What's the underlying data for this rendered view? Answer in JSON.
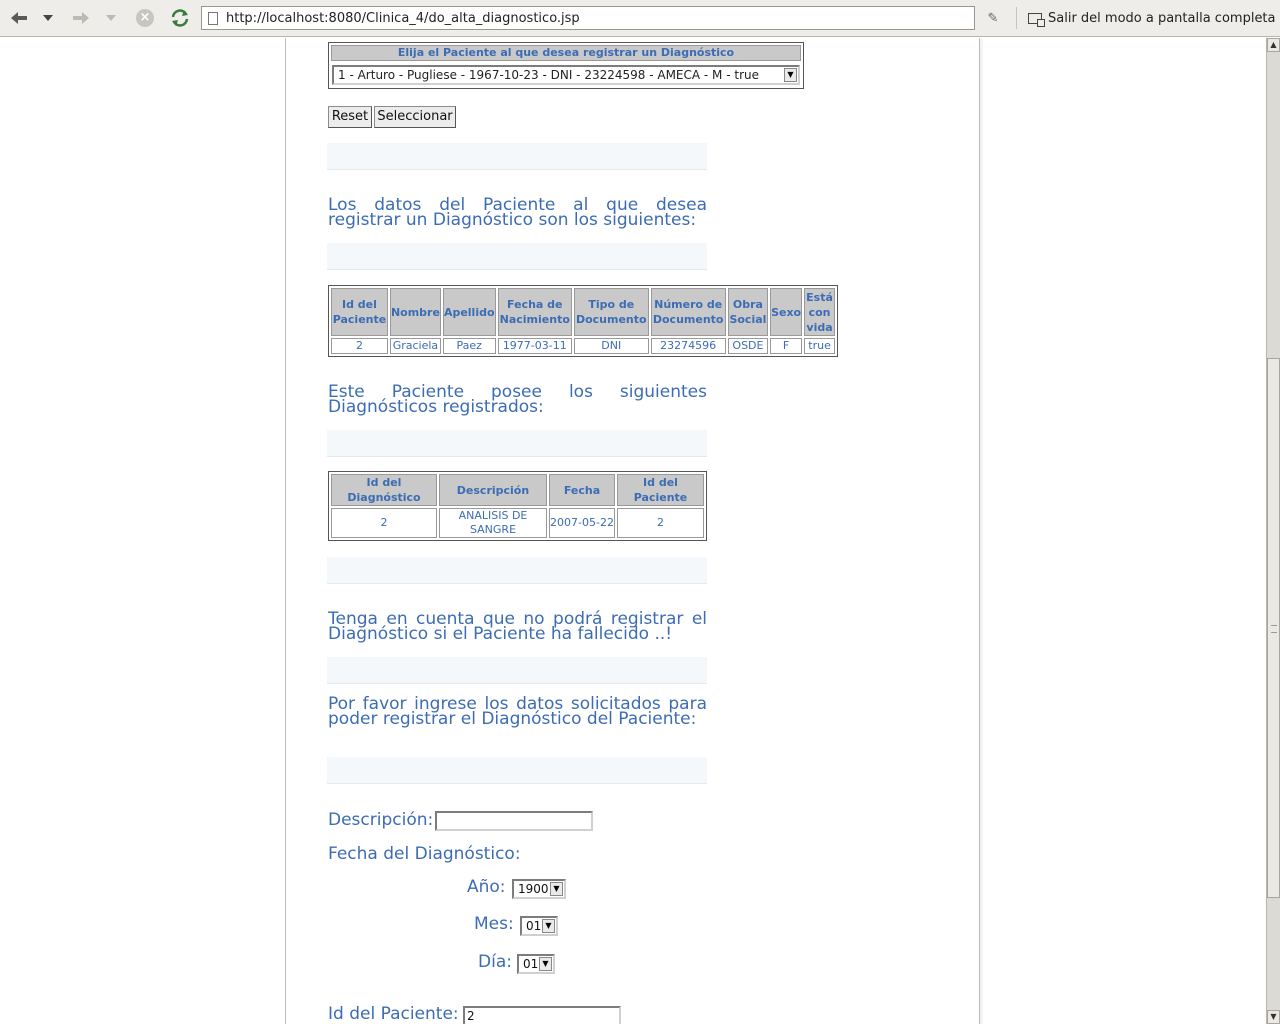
{
  "browser": {
    "url": "http://localhost:8080/Clinica_4/do_alta_diagnostico.jsp",
    "fullscreen_label": "Salir del modo a pantalla completa"
  },
  "patient_selector": {
    "header": "Elija el Paciente al que desea registrar un Diagnóstico",
    "selected": "1 - Arturo - Pugliese - 1967-10-23 - DNI - 23224598 - AMECA - M - true",
    "reset_label": "Reset",
    "select_label": "Seleccionar"
  },
  "patient_section": {
    "heading": "Los datos del Paciente al que desea registrar un Diagnóstico son los siguientes:",
    "columns": [
      "Id del Paciente",
      "Nombre",
      "Apellido",
      "Fecha de Nacimiento",
      "Tipo de Documento",
      "Número de Documento",
      "Obra Social",
      "Sexo",
      "Está con vida"
    ],
    "row": [
      "2",
      "Graciela",
      "Paez",
      "1977-03-11",
      "DNI",
      "23274596",
      "OSDE",
      "F",
      "true"
    ]
  },
  "diagnostics_section": {
    "heading": "Este Paciente posee los siguientes Diagnósticos registrados:",
    "columns": [
      "Id del Diagnóstico",
      "Descripción",
      "Fecha",
      "Id del Paciente"
    ],
    "row": [
      "2",
      "ANALISIS DE SANGRE",
      "2007-05-22",
      "2"
    ]
  },
  "warning": "Tenga en cuenta que no podrá registrar el Diagnóstico si el Paciente ha fallecido ..!",
  "instructions": "Por favor ingrese los datos solicitados para poder registrar el Diagnóstico del Paciente:",
  "form": {
    "descripcion_label": "Descripción:",
    "descripcion_value": "",
    "fecha_label": "Fecha del Diagnóstico:",
    "anio_label": "Año:",
    "anio_value": "1900",
    "mes_label": "Mes:",
    "mes_value": "01",
    "dia_label": "Día:",
    "dia_value": "01",
    "id_paciente_label": "Id del Paciente:",
    "id_paciente_value": "2"
  }
}
